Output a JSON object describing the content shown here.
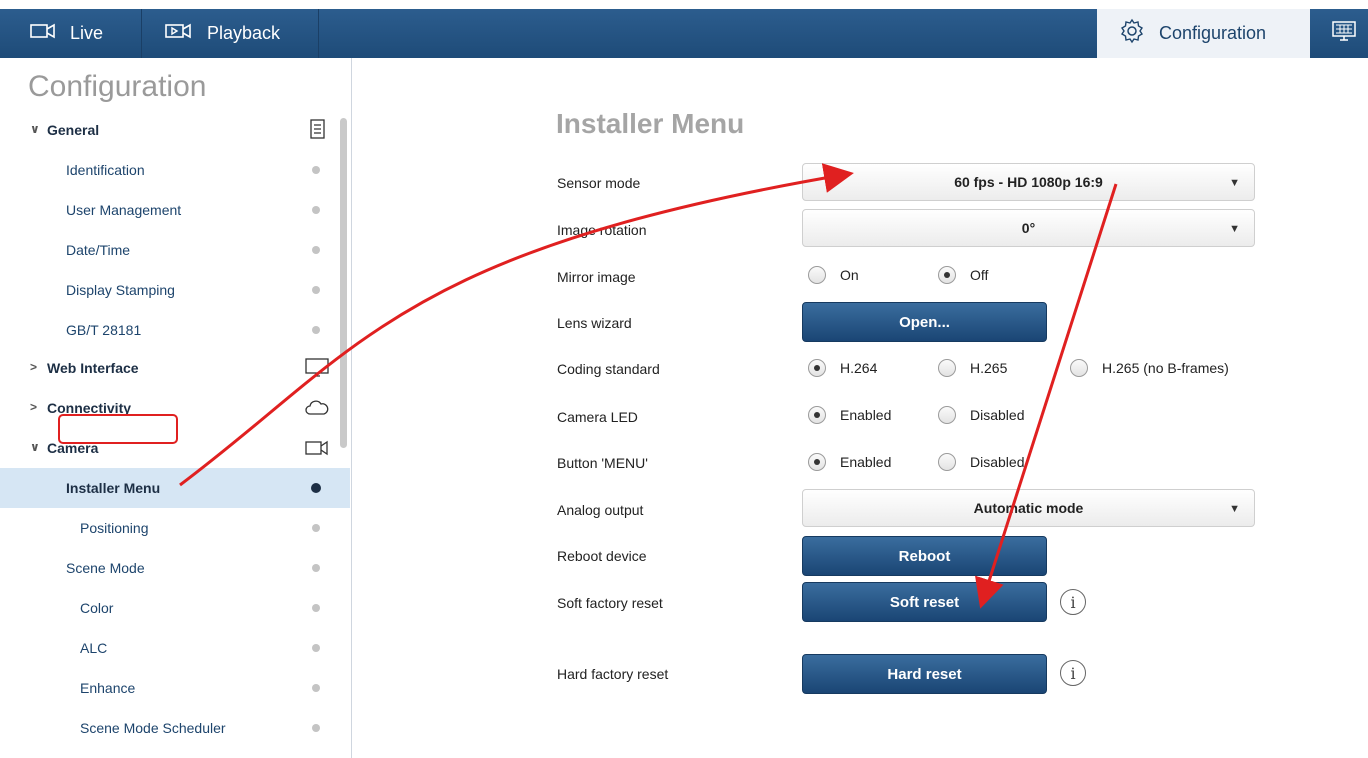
{
  "topbar": {
    "live_label": "Live",
    "playback_label": "Playback",
    "configuration_label": "Configuration",
    "live_icon": "camera-icon",
    "playback_icon": "playback-icon",
    "config_icon": "gear-icon",
    "extra_icon": "monitor-grid-icon"
  },
  "sidebar": {
    "title": "Configuration",
    "items": [
      {
        "label": "General",
        "kind": "section",
        "expanded": true,
        "icon": "checklist-icon"
      },
      {
        "label": "Identification",
        "kind": "item"
      },
      {
        "label": "User Management",
        "kind": "item"
      },
      {
        "label": "Date/Time",
        "kind": "item"
      },
      {
        "label": "Display Stamping",
        "kind": "item"
      },
      {
        "label": "GB/T 28181",
        "kind": "item"
      },
      {
        "label": "Web Interface",
        "kind": "section",
        "expanded": false,
        "icon": "monitor-icon"
      },
      {
        "label": "Connectivity",
        "kind": "section",
        "expanded": false,
        "icon": "cloud-icon"
      },
      {
        "label": "Camera",
        "kind": "section",
        "expanded": true,
        "icon": "camera-icon"
      },
      {
        "label": "Installer Menu",
        "kind": "item",
        "active": true
      },
      {
        "label": "Positioning",
        "kind": "subitem"
      },
      {
        "label": "Scene Mode",
        "kind": "item"
      },
      {
        "label": "Color",
        "kind": "subitem"
      },
      {
        "label": "ALC",
        "kind": "subitem"
      },
      {
        "label": "Enhance",
        "kind": "subitem"
      },
      {
        "label": "Scene Mode Scheduler",
        "kind": "subitem"
      }
    ]
  },
  "main": {
    "title": "Installer Menu",
    "sensor_mode": {
      "label": "Sensor mode",
      "value": "60 fps - HD 1080p 16:9"
    },
    "image_rotation": {
      "label": "Image rotation",
      "value": "0°"
    },
    "mirror_image": {
      "label": "Mirror image",
      "options": [
        "On",
        "Off"
      ],
      "selected": "Off"
    },
    "lens_wizard": {
      "label": "Lens wizard",
      "button": "Open..."
    },
    "coding_standard": {
      "label": "Coding standard",
      "options": [
        "H.264",
        "H.265",
        "H.265 (no B-frames)"
      ],
      "selected": "H.264"
    },
    "camera_led": {
      "label": "Camera LED",
      "options": [
        "Enabled",
        "Disabled"
      ],
      "selected": "Enabled"
    },
    "button_menu": {
      "label": "Button 'MENU'",
      "options": [
        "Enabled",
        "Disabled"
      ],
      "selected": "Enabled"
    },
    "analog_output": {
      "label": "Analog output",
      "value": "Automatic mode"
    },
    "reboot": {
      "label": "Reboot device",
      "button": "Reboot"
    },
    "soft_reset": {
      "label": "Soft factory reset",
      "button": "Soft reset"
    },
    "hard_reset": {
      "label": "Hard factory reset",
      "button": "Hard reset"
    }
  },
  "annotation": {
    "arrow_color": "#e02020"
  }
}
